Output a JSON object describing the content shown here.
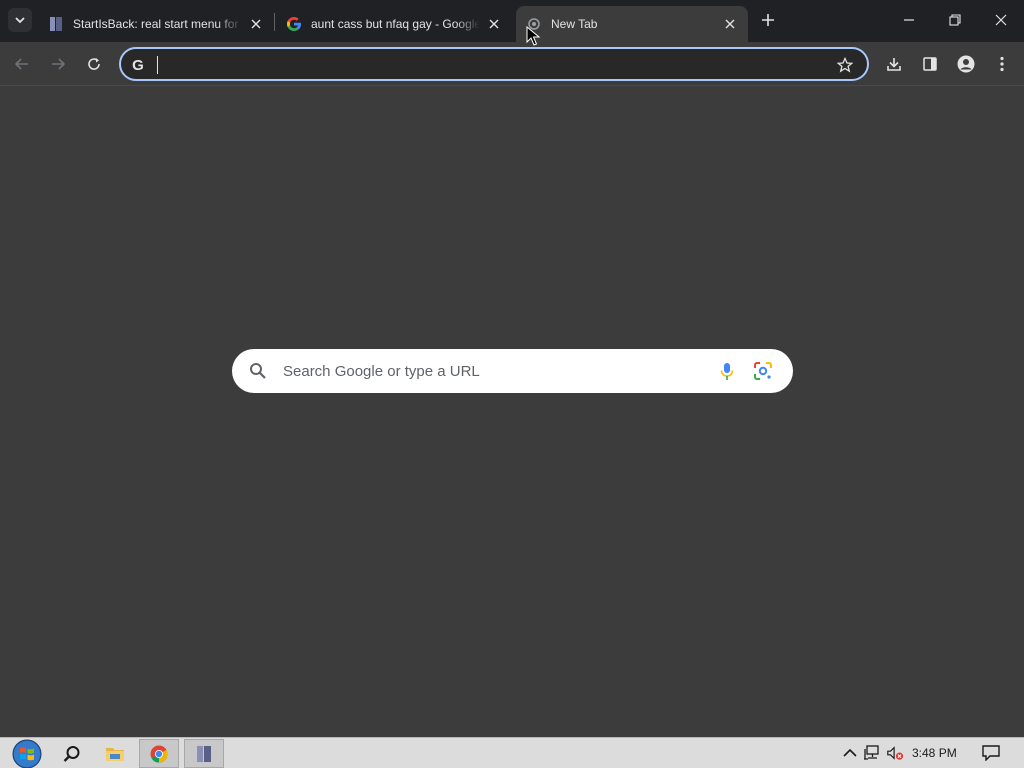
{
  "browser": {
    "tabs": [
      {
        "title": "StartIsBack: real start menu for Windows",
        "favicon": "book-icon",
        "active": false
      },
      {
        "title": "aunt cass but nfaq gay - Google Search",
        "favicon": "google-g-icon",
        "active": false
      },
      {
        "title": "New Tab",
        "favicon": "chrome-newtab-icon",
        "active": true
      }
    ],
    "omnibox": {
      "value": "",
      "placeholder": ""
    },
    "window_controls": [
      "minimize",
      "restore",
      "close"
    ]
  },
  "ntp": {
    "search_placeholder": "Search Google or type a URL"
  },
  "taskbar": {
    "items": [
      "start-orb",
      "search",
      "file-explorer",
      "chrome",
      "startisback"
    ],
    "clock": "3:48 PM"
  },
  "colors": {
    "accent": "#a8c7fa",
    "background": "#3c3c3c",
    "tabstrip": "#202124"
  }
}
